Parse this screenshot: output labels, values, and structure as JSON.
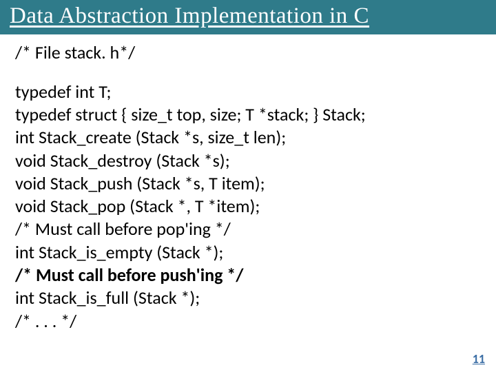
{
  "title": "Data Abstraction Implementation in C",
  "file_comment": "/* File stack. h*/",
  "code": {
    "l1": "typedef int T;",
    "l2": "typedef struct { size_t top, size; T *stack; } Stack;",
    "l3": "int Stack_create (Stack *s, size_t len);",
    "l4": "void Stack_destroy (Stack *s);",
    "l5": "void Stack_push (Stack *s, T item);",
    "l6": "void Stack_pop (Stack *, T *item);",
    "l7": "/* Must call before pop'ing */",
    "l8": "int Stack_is_empty (Stack *);",
    "l9": "/* Must call before push'ing */",
    "l10": "int Stack_is_full (Stack *);",
    "l11": "/* . . . */"
  },
  "page_number": "11"
}
